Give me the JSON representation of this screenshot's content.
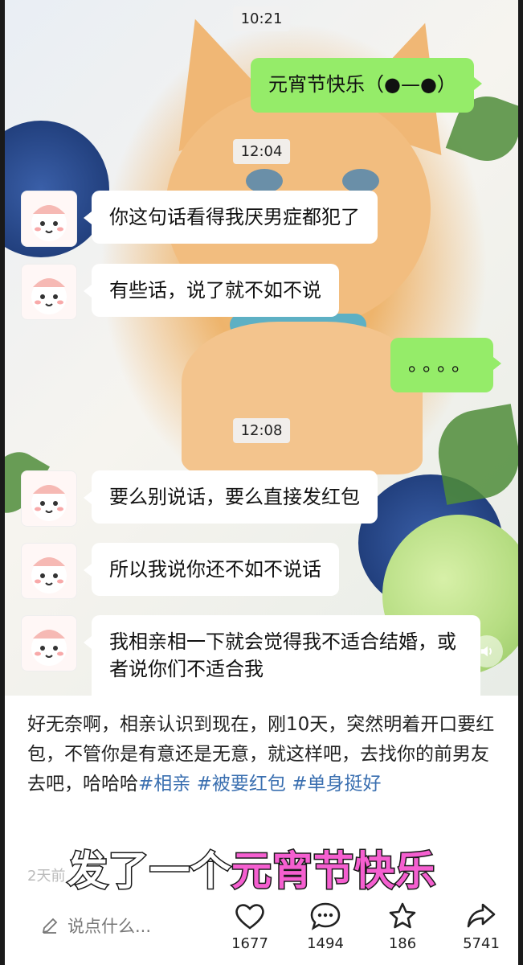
{
  "chat": {
    "timestamps": [
      "10:21",
      "12:04",
      "12:08"
    ],
    "messages": [
      {
        "side": "right",
        "text": "元宵节快乐（●—●）"
      },
      {
        "side": "left",
        "text": "你这句话看得我厌男症都犯了"
      },
      {
        "side": "left",
        "text": "有些话，说了就不如不说"
      },
      {
        "side": "right",
        "text": "。。。。"
      },
      {
        "side": "left",
        "text": "要么别说话，要么直接发红包"
      },
      {
        "side": "left",
        "text": "所以我说你还不如不说话"
      },
      {
        "side": "left",
        "text": "我相亲相一下就会觉得我不适合结婚，或者说你们不适合我"
      }
    ]
  },
  "post": {
    "caption_text": "好无奈啊，相亲认识到现在，刚10天，突然明着开口要红包，不管你是有意还是无意，就这样吧，去找你的前男友去吧，哈哈哈",
    "tags": [
      "#相亲",
      "#被要红包",
      "#单身挺好"
    ],
    "time": "2天前",
    "overlay_white": "发了一个",
    "overlay_pink": "元宵节快乐"
  },
  "bottom_bar": {
    "comment_placeholder": "说点什么...",
    "like_count": "1677",
    "comment_count": "1494",
    "star_count": "186",
    "share_count": "5741"
  },
  "colors": {
    "bubble_green": "#95ec69",
    "tag_blue": "#3a6fb0",
    "overlay_pink": "#f55fd0"
  },
  "icons": [
    "edit-pen-icon",
    "heart-icon",
    "comment-bubble-icon",
    "star-icon",
    "share-arrow-icon",
    "volume-icon"
  ]
}
